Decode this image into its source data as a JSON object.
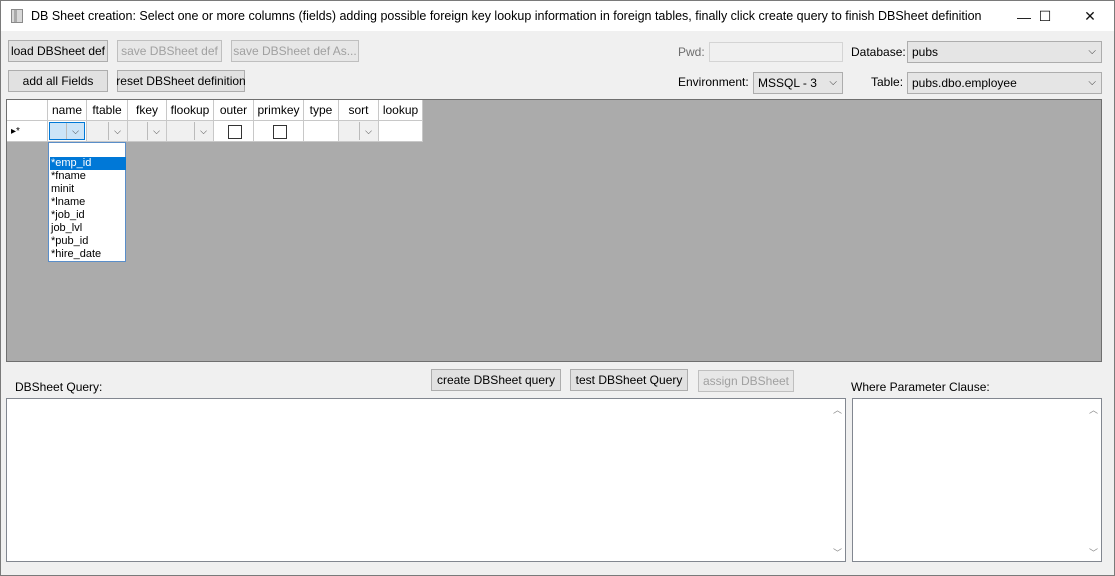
{
  "window": {
    "title": "DB Sheet creation: Select one or more columns (fields) adding possible foreign key lookup information in foreign tables, finally click create query to finish DBSheet definition",
    "controls": {
      "minimize": "—",
      "maximize": "☐",
      "close": "✕"
    }
  },
  "toolbar": {
    "load": "load DBSheet def",
    "save": "save DBSheet def",
    "save_as": "save DBSheet def As...",
    "add_all": "add all Fields",
    "reset": "reset DBSheet definition"
  },
  "connection": {
    "pwd_label": "Pwd:",
    "pwd_value": "",
    "database_label": "Database:",
    "database_value": "pubs",
    "environment_label": "Environment:",
    "environment_value": "MSSQL - 3",
    "table_label": "Table:",
    "table_value": "pubs.dbo.employee"
  },
  "grid": {
    "columns": [
      "name",
      "ftable",
      "fkey",
      "flookup",
      "outer",
      "primkey",
      "type",
      "sort",
      "lookup"
    ],
    "row_marker": "▸*",
    "name_dropdown": [
      "",
      "*emp_id",
      "*fname",
      "minit",
      "*lname",
      "*job_id",
      "job_lvl",
      "*pub_id",
      "*hire_date"
    ],
    "selected_index": 1
  },
  "query": {
    "query_label": "DBSheet Query:",
    "create": "create DBSheet query",
    "test": "test DBSheet Query",
    "assign": "assign DBSheet",
    "where_label": "Where Parameter Clause:",
    "query_text": "",
    "where_text": ""
  },
  "icons": {
    "app": "app-icon",
    "dropdown": "chevron-down-icon",
    "scroll_up": "scroll-up-icon",
    "scroll_down": "scroll-down-icon"
  }
}
